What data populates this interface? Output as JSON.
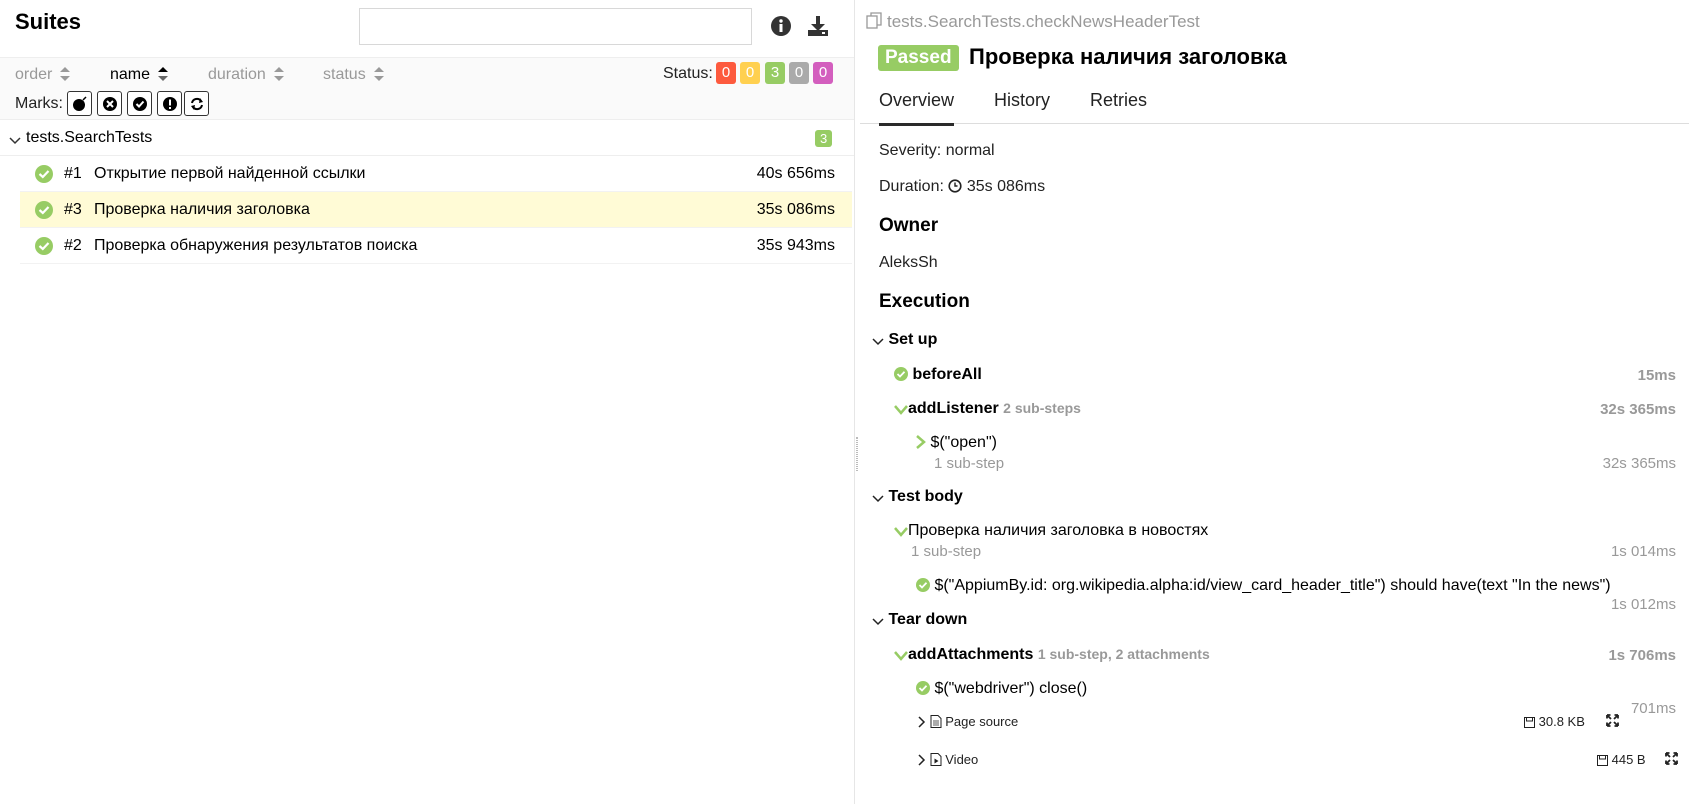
{
  "left": {
    "title": "Suites",
    "search_value": "",
    "sort": [
      {
        "label": "order",
        "active": false
      },
      {
        "label": "name",
        "active": true
      },
      {
        "label": "duration",
        "active": false
      },
      {
        "label": "status",
        "active": false
      }
    ],
    "status_label": "Status:",
    "status_counts": [
      {
        "value": "0",
        "color": "#fd5a3e"
      },
      {
        "value": "0",
        "color": "#ffd050"
      },
      {
        "value": "3",
        "color": "#97cc64"
      },
      {
        "value": "0",
        "color": "#aaaaaa"
      },
      {
        "value": "0",
        "color": "#d35ebe"
      }
    ],
    "marks_label": "Marks:",
    "marks": [
      "flaky-icon",
      "new-failed-icon",
      "new-passed-icon",
      "new-broken-icon",
      "retries-icon"
    ],
    "group": {
      "name": "tests.SearchTests",
      "count": "3"
    },
    "tests": [
      {
        "num": "#1",
        "name": "Открытие первой найденной ссылки",
        "duration": "40s 656ms",
        "selected": false
      },
      {
        "num": "#3",
        "name": "Проверка наличия заголовка",
        "duration": "35s 086ms",
        "selected": true
      },
      {
        "num": "#2",
        "name": "Проверка обнаружения результатов поиска",
        "duration": "35s 943ms",
        "selected": false
      }
    ]
  },
  "right": {
    "breadcrumb": "tests.SearchTests.checkNewsHeaderTest",
    "status_badge": "Passed",
    "title": "Проверка наличия заголовка",
    "tabs": [
      "Overview",
      "History",
      "Retries"
    ],
    "severity": "Severity: normal",
    "duration_label": "Duration:",
    "duration_value": "35s 086ms",
    "owner_heading": "Owner",
    "owner": "AleksSh",
    "execution_heading": "Execution",
    "setup": {
      "label": "Set up",
      "before_all": {
        "name": "beforeAll",
        "duration": "15ms"
      },
      "add_listener": {
        "name": "addListener",
        "sub": "2 sub-steps",
        "duration": "32s 365ms"
      },
      "open_step": {
        "name": "$(\"open\")",
        "sub": "1 sub-step",
        "duration": "32s 365ms"
      }
    },
    "body": {
      "label": "Test body",
      "step": {
        "name": "Проверка наличия заголовка в новостях",
        "sub": "1 sub-step",
        "duration": "1s 014ms"
      },
      "inner": {
        "name": "$(\"AppiumBy.id: org.wikipedia.alpha:id/view_card_header_title\") should have(text \"In the news\")",
        "duration": "1s 012ms"
      }
    },
    "teardown": {
      "label": "Tear down",
      "step": {
        "name": "addAttachments",
        "sub": "1 sub-step, 2 attachments",
        "duration": "1s 706ms"
      },
      "close": {
        "name": "$(\"webdriver\") close()",
        "duration": "701ms"
      },
      "attachments": [
        {
          "name": "Page source",
          "size": "30.8 KB"
        },
        {
          "name": "Video",
          "size": "445 B"
        }
      ]
    }
  }
}
